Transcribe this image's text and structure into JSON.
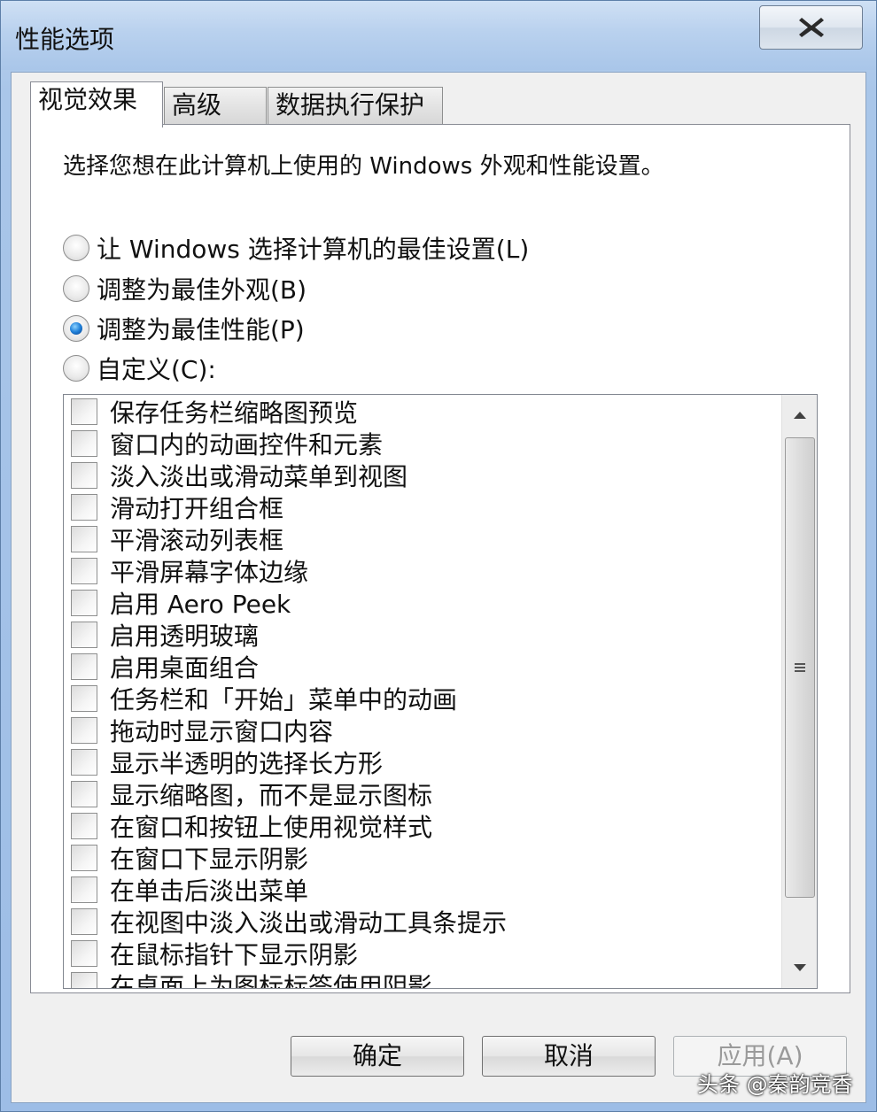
{
  "window": {
    "title": "性能选项"
  },
  "tabs": [
    {
      "label": "视觉效果",
      "active": true
    },
    {
      "label": "高级",
      "active": false
    },
    {
      "label": "数据执行保护",
      "active": false
    }
  ],
  "panel": {
    "description": "选择您想在此计算机上使用的 Windows 外观和性能设置。",
    "radios": [
      {
        "label": "让 Windows 选择计算机的最佳设置(L)",
        "checked": false
      },
      {
        "label": "调整为最佳外观(B)",
        "checked": false
      },
      {
        "label": "调整为最佳性能(P)",
        "checked": true
      },
      {
        "label": "自定义(C):",
        "checked": false
      }
    ],
    "items": [
      "保存任务栏缩略图预览",
      "窗口内的动画控件和元素",
      "淡入淡出或滑动菜单到视图",
      "滑动打开组合框",
      "平滑滚动列表框",
      "平滑屏幕字体边缘",
      "启用 Aero Peek",
      "启用透明玻璃",
      "启用桌面组合",
      "任务栏和「开始」菜单中的动画",
      "拖动时显示窗口内容",
      "显示半透明的选择长方形",
      "显示缩略图，而不是显示图标",
      "在窗口和按钮上使用视觉样式",
      "在窗口下显示阴影",
      "在单击后淡出菜单",
      "在视图中淡入淡出或滑动工具条提示",
      "在鼠标指针下显示阴影",
      "在桌面上为图标标签使用阴影"
    ]
  },
  "buttons": {
    "ok": "确定",
    "cancel": "取消",
    "apply": "应用(A)"
  },
  "watermark": "头条 @秦韵竞香"
}
